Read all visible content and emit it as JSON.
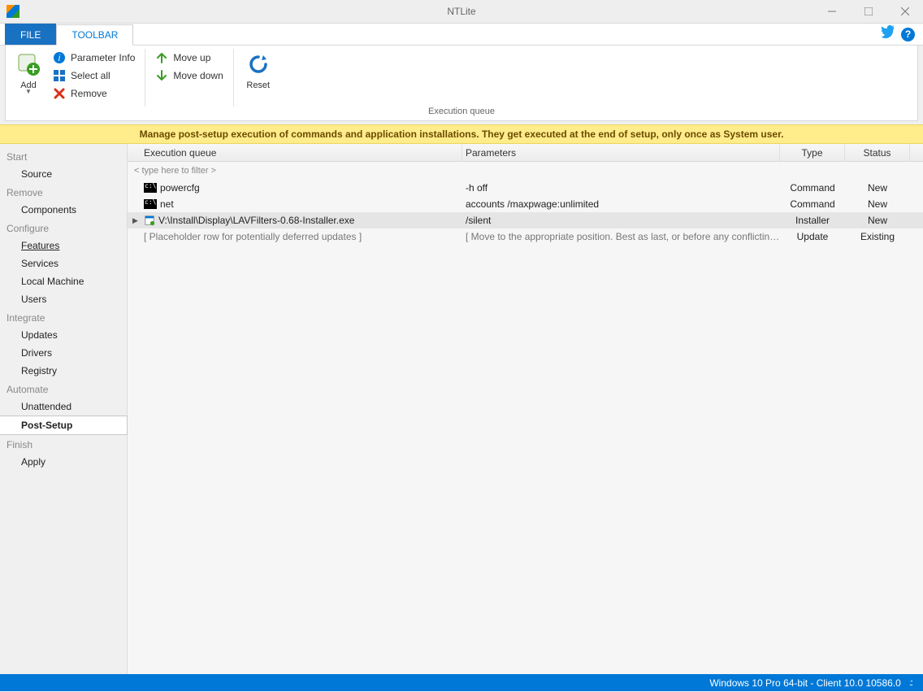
{
  "window": {
    "title": "NTLite"
  },
  "tabs": {
    "file": "FILE",
    "toolbar": "TOOLBAR"
  },
  "ribbon": {
    "add": "Add",
    "param_info": "Parameter Info",
    "select_all": "Select all",
    "remove": "Remove",
    "move_up": "Move up",
    "move_down": "Move down",
    "reset": "Reset",
    "group_label": "Execution queue"
  },
  "banner": "Manage post-setup execution of commands and application installations. They get executed at the end of setup, only once as System user.",
  "sidebar": {
    "start": "Start",
    "source": "Source",
    "remove": "Remove",
    "components": "Components",
    "configure": "Configure",
    "features": "Features",
    "services": "Services",
    "local_machine": "Local Machine",
    "users": "Users",
    "integrate": "Integrate",
    "updates": "Updates",
    "drivers": "Drivers",
    "registry": "Registry",
    "automate": "Automate",
    "unattended": "Unattended",
    "post_setup": "Post-Setup",
    "finish": "Finish",
    "apply": "Apply"
  },
  "grid": {
    "headers": {
      "queue": "Execution queue",
      "params": "Parameters",
      "type": "Type",
      "status": "Status"
    },
    "filter_placeholder": "< type here to filter >",
    "rows": [
      {
        "icon": "cmd",
        "name": "powercfg",
        "params": "-h off",
        "type": "Command",
        "status": "New",
        "sel": false
      },
      {
        "icon": "cmd",
        "name": "net",
        "params": "accounts /maxpwage:unlimited",
        "type": "Command",
        "status": "New",
        "sel": false
      },
      {
        "icon": "inst",
        "name": "V:\\Install\\Display\\LAVFilters-0.68-Installer.exe",
        "params": "/silent",
        "type": "Installer",
        "status": "New",
        "sel": true
      },
      {
        "icon": "none",
        "name": "[ Placeholder row for potentially deferred updates ]",
        "params": "[ Move to the appropriate position. Best as last, or before any conflicting executi...",
        "type": "Update",
        "status": "Existing",
        "sel": false,
        "pl": true
      }
    ]
  },
  "status": "Windows 10 Pro 64-bit - Client 10.0 10586.0"
}
